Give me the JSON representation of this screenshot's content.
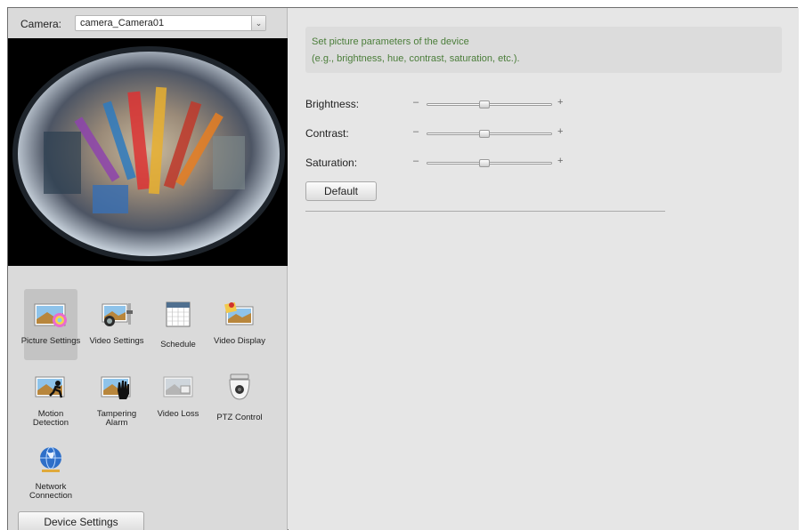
{
  "camera": {
    "label": "Camera:",
    "selected": "camera_Camera01",
    "dropdown_icon": "chevron-down-icon"
  },
  "icons": [
    {
      "id": "picture-settings",
      "label": "Picture Settings",
      "icon": "picture-color-icon",
      "selected": true
    },
    {
      "id": "video-settings",
      "label": "Video Settings",
      "icon": "video-camera-icon",
      "selected": false
    },
    {
      "id": "schedule",
      "label": "Schedule",
      "icon": "calendar-icon",
      "selected": false
    },
    {
      "id": "video-display",
      "label": "Video Display",
      "icon": "display-pin-icon",
      "selected": false
    },
    {
      "id": "motion-detection",
      "label": "Motion Detection",
      "icon": "running-person-icon",
      "selected": false
    },
    {
      "id": "tampering-alarm",
      "label": "Tampering Alarm",
      "icon": "hand-icon",
      "selected": false
    },
    {
      "id": "video-loss",
      "label": "Video Loss",
      "icon": "video-loss-icon",
      "selected": false
    },
    {
      "id": "ptz-control",
      "label": "PTZ Control",
      "icon": "dome-camera-icon",
      "selected": false
    },
    {
      "id": "network-connection",
      "label": "Network Connection",
      "icon": "globe-icon",
      "selected": false
    }
  ],
  "footer": {
    "device_settings": "Device Settings"
  },
  "info": {
    "line1": "Set picture parameters of the device",
    "line2": "(e.g., brightness, hue, contrast, saturation, etc.)."
  },
  "sliders": [
    {
      "label": "Brightness:",
      "value": 0.45,
      "min_symbol": "–",
      "max_symbol": "+"
    },
    {
      "label": "Contrast:",
      "value": 0.45,
      "min_symbol": "–",
      "max_symbol": "+"
    },
    {
      "label": "Saturation:",
      "value": 0.45,
      "min_symbol": "–",
      "max_symbol": "+"
    }
  ],
  "buttons": {
    "default": "Default"
  },
  "colors": {
    "accent_text": "#4a7d39",
    "panel": "#dadada",
    "content": "#e6e6e6"
  }
}
